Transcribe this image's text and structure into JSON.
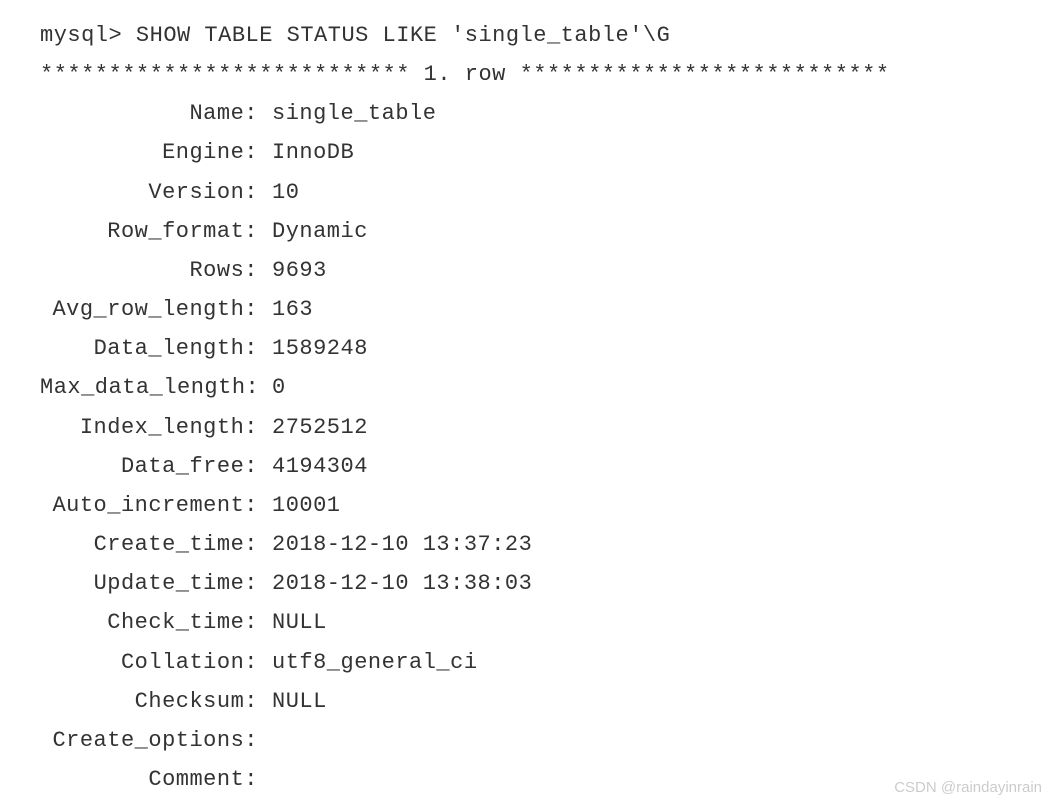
{
  "cmd": "mysql> SHOW TABLE STATUS LIKE 'single_table'\\G",
  "divider": "*************************** 1. row ***************************",
  "fields": {
    "Name": {
      "label": "Name:",
      "value": "single_table"
    },
    "Engine": {
      "label": "Engine:",
      "value": "InnoDB"
    },
    "Version": {
      "label": "Version:",
      "value": "10"
    },
    "Row_format": {
      "label": "Row_format:",
      "value": "Dynamic"
    },
    "Rows": {
      "label": "Rows:",
      "value": "9693"
    },
    "Avg_row_length": {
      "label": "Avg_row_length:",
      "value": "163"
    },
    "Data_length": {
      "label": "Data_length:",
      "value": "1589248"
    },
    "Max_data_length": {
      "label": "Max_data_length:",
      "value": "0"
    },
    "Index_length": {
      "label": "Index_length:",
      "value": "2752512"
    },
    "Data_free": {
      "label": "Data_free:",
      "value": "4194304"
    },
    "Auto_increment": {
      "label": "Auto_increment:",
      "value": "10001"
    },
    "Create_time": {
      "label": "Create_time:",
      "value": "2018-12-10 13:37:23"
    },
    "Update_time": {
      "label": "Update_time:",
      "value": "2018-12-10 13:38:03"
    },
    "Check_time": {
      "label": "Check_time:",
      "value": "NULL"
    },
    "Collation": {
      "label": "Collation:",
      "value": "utf8_general_ci"
    },
    "Checksum": {
      "label": "Checksum:",
      "value": "NULL"
    },
    "Create_options": {
      "label": "Create_options:",
      "value": ""
    },
    "Comment": {
      "label": "Comment:",
      "value": ""
    }
  },
  "watermark": "CSDN @raindayinrain"
}
